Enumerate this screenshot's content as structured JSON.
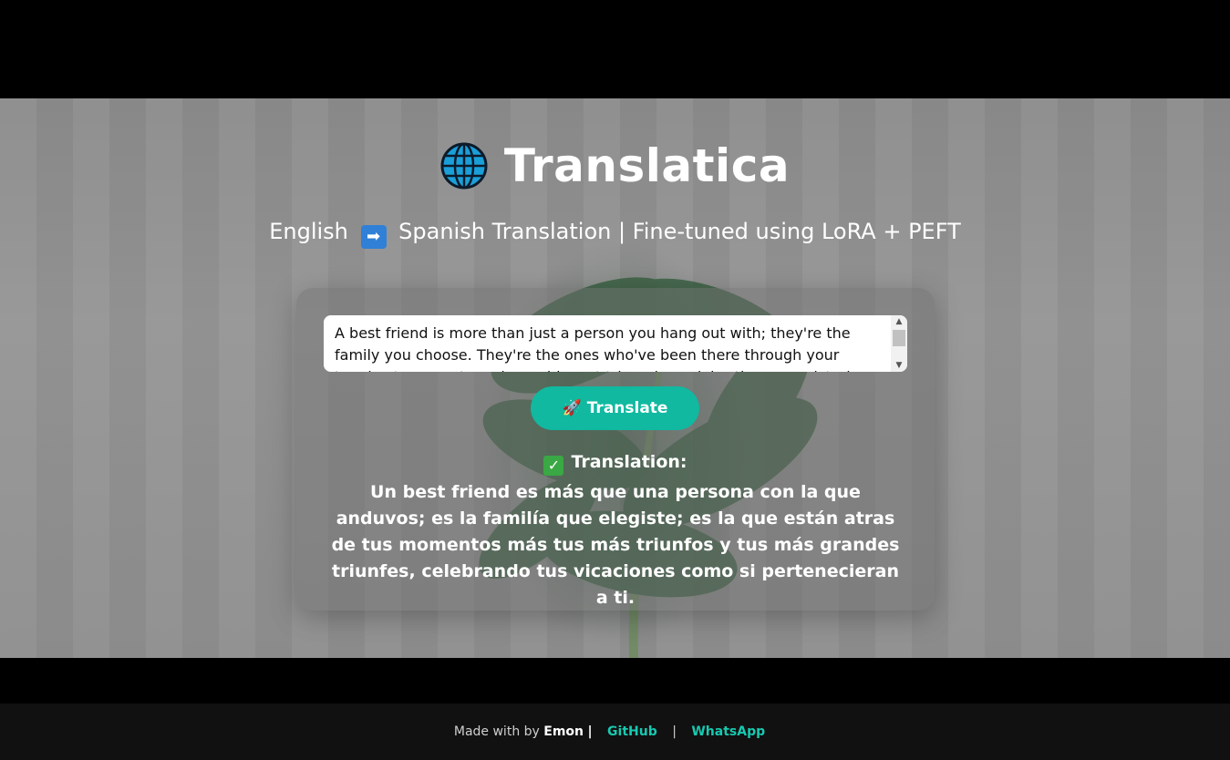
{
  "app": {
    "title": "Translatica",
    "subtitle_left": "English",
    "subtitle_right": "Spanish Translation | Fine-tuned using LoRA + PEFT"
  },
  "input": {
    "value": "A best friend is more than just a person you hang out with; they're the family you choose. They're the ones who've been there through your toughest moments and your biggest triumphs, celebrating your victories as if they were their own."
  },
  "button": {
    "label": "Translate"
  },
  "result": {
    "heading": "Translation:",
    "text": "Un best friend es más que una persona con la que anduvos; es la familía que elegiste; es la que están atras de tus momentos más tus más triunfos y tus más grandes triunfes, celebrando tus vicaciones como si pertenecieran a ti."
  },
  "footer": {
    "made_with": "Made with by",
    "author": "Emon",
    "sep1": "|",
    "github": "GitHub",
    "sep2": "|",
    "whatsapp": "WhatsApp"
  },
  "colors": {
    "accent": "#10b9a0",
    "link": "#17c9b0"
  }
}
